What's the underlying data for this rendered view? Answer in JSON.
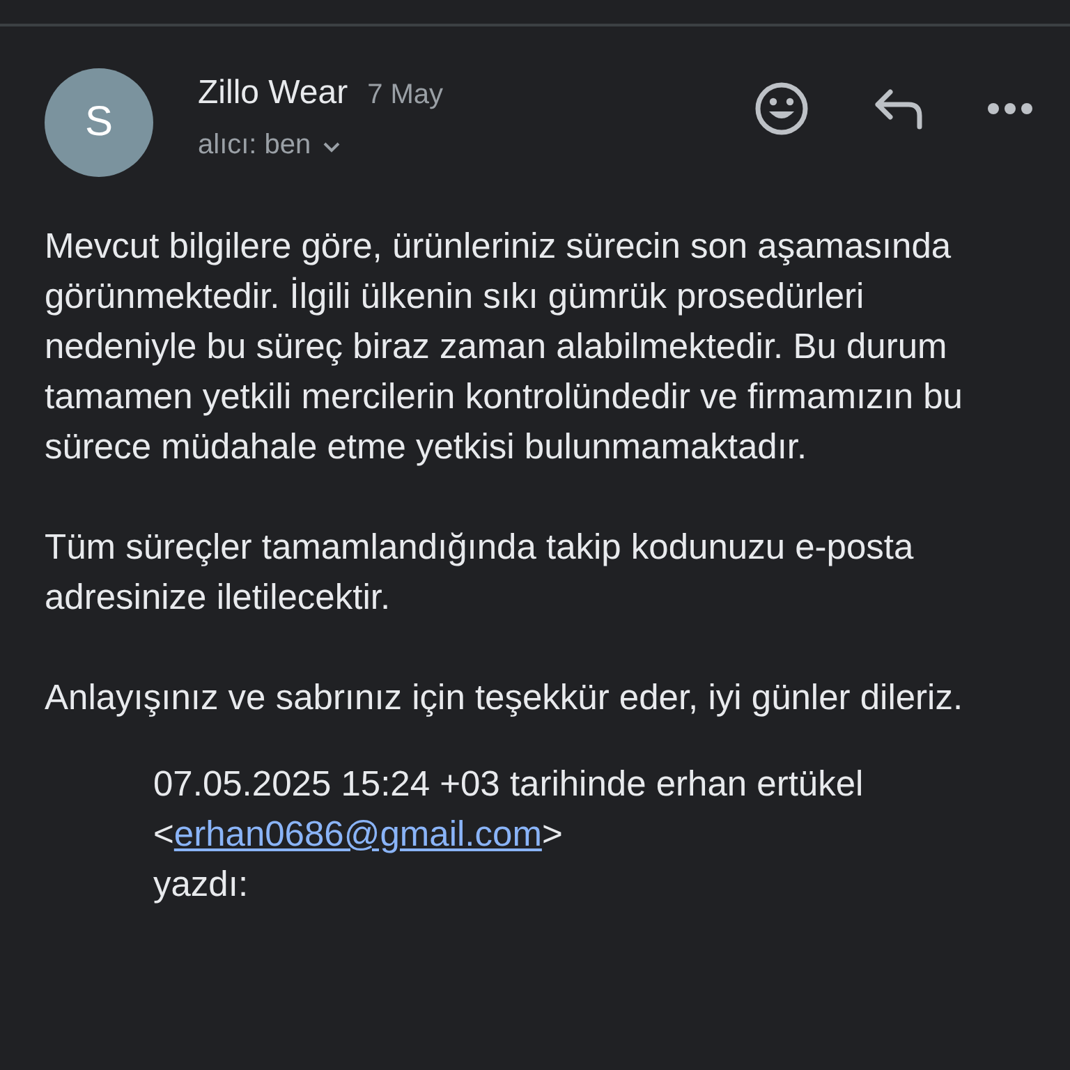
{
  "sender": {
    "avatar_letter": "S",
    "name": "Zillo Wear",
    "date": "7 May",
    "recipient": "alıcı: ben"
  },
  "body": [
    "Mevcut bilgilere göre, ürünleriniz sürecin son aşamasında görünmektedir. İlgili ülkenin sıkı gümrük prosedürleri nedeniyle bu süreç biraz zaman alabilmektedir. Bu durum tamamen yetkili mercilerin kontrolündedir ve firmamızın bu sürece müdahale etme yetkisi bulunmamaktadır.",
    "Tüm süreçler tamamlandığında takip kodunuzu e-posta adresinize iletilecektir.",
    "Anlayışınız ve sabrınız için teşekkür eder, iyi günler dileriz."
  ],
  "quote": {
    "before": "07.05.2025 15:24 +03 tarihinde erhan ertükel <",
    "link": "erhan0686@gmail.com",
    "after": ">",
    "last": "yazdı:"
  }
}
